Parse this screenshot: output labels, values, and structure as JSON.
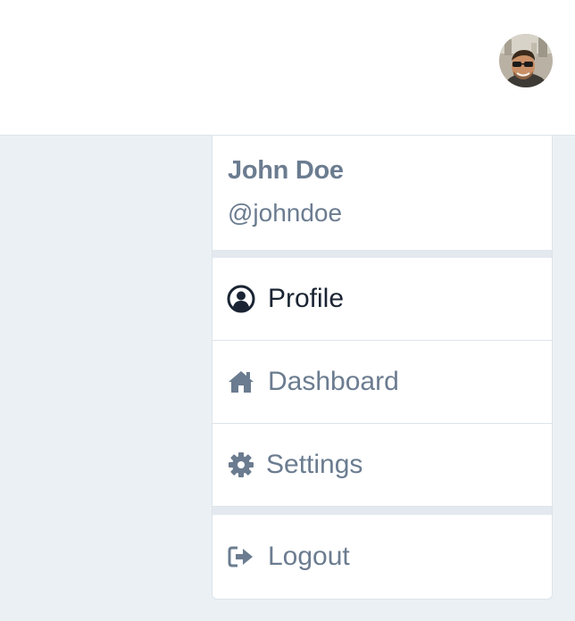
{
  "user": {
    "name": "John Doe",
    "handle": "@johndoe"
  },
  "menu": {
    "items": [
      {
        "label": "Profile",
        "icon": "user-circle-icon",
        "active": true
      },
      {
        "label": "Dashboard",
        "icon": "home-icon",
        "active": false
      },
      {
        "label": "Settings",
        "icon": "gear-icon",
        "active": false
      },
      {
        "label": "Logout",
        "icon": "sign-out-icon",
        "active": false
      }
    ]
  },
  "colors": {
    "page_background": "#eaf0f4",
    "muted_text": "#6b7c90",
    "active_text": "#1a2433",
    "divider": "#e3e9ef"
  }
}
